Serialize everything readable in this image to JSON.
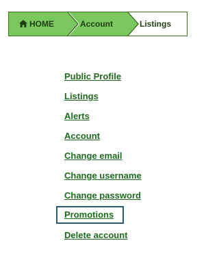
{
  "breadcrumb": {
    "home_icon": "home-icon",
    "items": [
      {
        "label": "HOME",
        "color": "#7bc85f",
        "active": false
      },
      {
        "label": "Account",
        "color": "#7bc85f",
        "active": false
      },
      {
        "label": "Listings",
        "color": "#ffffff",
        "active": true
      }
    ]
  },
  "menu": {
    "items": [
      {
        "label": "Public Profile"
      },
      {
        "label": "Listings"
      },
      {
        "label": "Alerts"
      },
      {
        "label": "Account"
      },
      {
        "label": "Change email"
      },
      {
        "label": "Change username"
      },
      {
        "label": "Change password"
      },
      {
        "label": "Promotions",
        "focused": true
      },
      {
        "label": "Delete account"
      }
    ]
  },
  "colors": {
    "crumb_fill": "#7bc85f",
    "crumb_border": "#3c6e1e",
    "link": "#1e6a1e",
    "focus_ring": "#2a5a7a"
  }
}
